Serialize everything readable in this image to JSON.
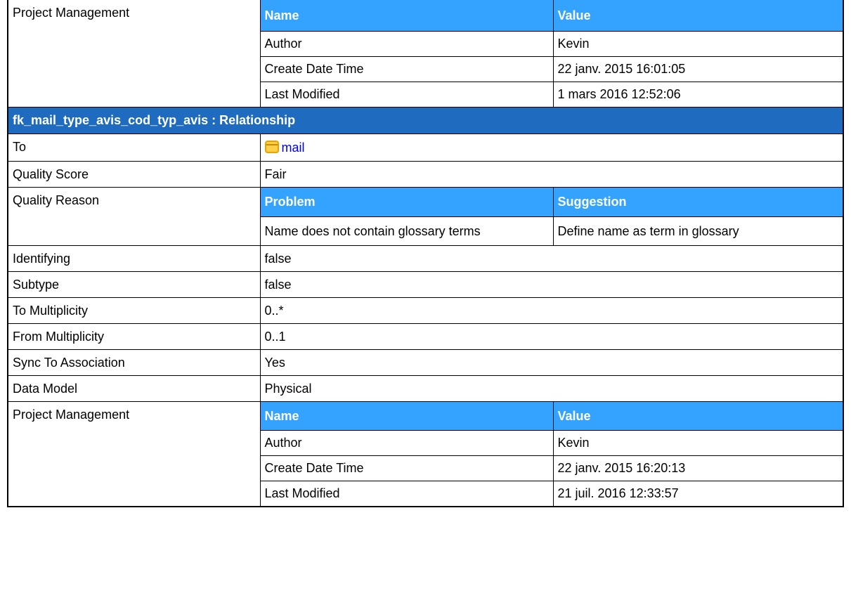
{
  "top_project_management": {
    "label": "Project Management",
    "headers": {
      "name": "Name",
      "value": "Value"
    },
    "rows": [
      {
        "name": "Author",
        "value": "Kevin"
      },
      {
        "name": "Create Date Time",
        "value": "22 janv. 2015 16:01:05"
      },
      {
        "name": "Last Modified",
        "value": "1 mars 2016 12:52:06"
      }
    ]
  },
  "relationship": {
    "title": "fk_mail_type_avis_cod_typ_avis : Relationship",
    "to": {
      "label": "To",
      "icon": "table-icon",
      "link_text": "mail"
    },
    "quality_score": {
      "label": "Quality Score",
      "value": "Fair"
    },
    "quality_reason": {
      "label": "Quality Reason",
      "headers": {
        "problem": "Problem",
        "suggestion": "Suggestion"
      },
      "rows": [
        {
          "problem": "Name does not contain glossary terms",
          "suggestion": "Define name as term in glossary"
        }
      ]
    },
    "identifying": {
      "label": "Identifying",
      "value": "false"
    },
    "subtype": {
      "label": "Subtype",
      "value": "false"
    },
    "to_multiplicity": {
      "label": "To Multiplicity",
      "value": "0..*"
    },
    "from_multiplicity": {
      "label": "From Multiplicity",
      "value": "0..1"
    },
    "sync_to_association": {
      "label": "Sync To Association",
      "value": "Yes"
    },
    "data_model": {
      "label": "Data Model",
      "value": "Physical"
    },
    "project_management": {
      "label": "Project Management",
      "headers": {
        "name": "Name",
        "value": "Value"
      },
      "rows": [
        {
          "name": "Author",
          "value": "Kevin"
        },
        {
          "name": "Create Date Time",
          "value": "22 janv. 2015 16:20:13"
        },
        {
          "name": "Last Modified",
          "value": "21 juil. 2016 12:33:57"
        }
      ]
    }
  },
  "colors": {
    "section_header": "#1f6bbf",
    "table_header": "#33a3ff",
    "link": "#0000ee"
  }
}
